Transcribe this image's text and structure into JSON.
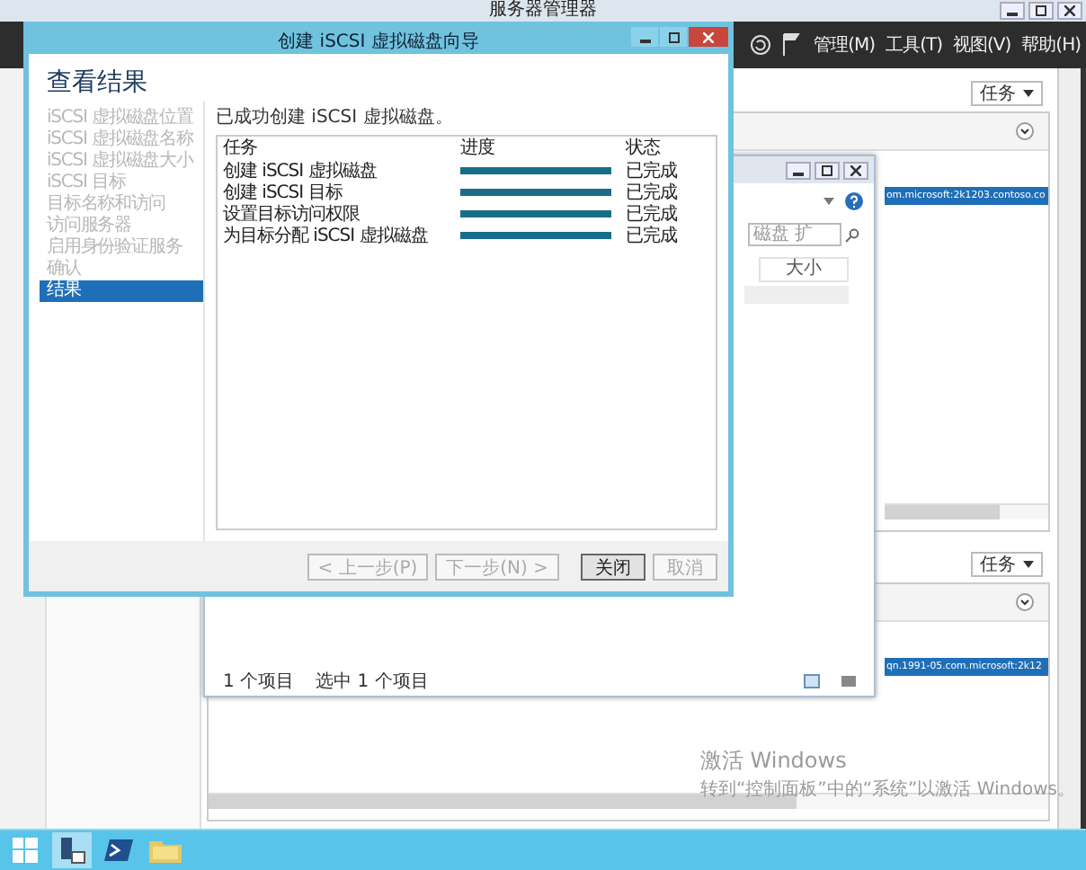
{
  "window": {
    "title": "服务器管理器"
  },
  "header": {
    "menus": [
      "管理(M)",
      "工具(T)",
      "视图(V)",
      "帮助(H)"
    ]
  },
  "panels": [
    {
      "tasks_label": "任务",
      "selected_item": "om.microsoft:2k1203.contoso.co"
    },
    {
      "tasks_label": "任务",
      "selected_item": "qn.1991-05.com.microsoft:2k12"
    }
  ],
  "file_window": {
    "search": {
      "placeholder": "磁盘 扩"
    },
    "column": "大小",
    "status": [
      "1 个项目",
      "选中 1 个项目"
    ]
  },
  "wizard": {
    "title": "创建 iSCSI 虚拟磁盘向导",
    "heading": "查看结果",
    "steps": [
      {
        "label": "iSCSI 虚拟磁盘位置",
        "selected": false
      },
      {
        "label": "iSCSI 虚拟磁盘名称",
        "selected": false
      },
      {
        "label": "iSCSI 虚拟磁盘大小",
        "selected": false
      },
      {
        "label": "iSCSI 目标",
        "selected": false
      },
      {
        "label": "目标名称和访问",
        "selected": false
      },
      {
        "label": "访问服务器",
        "selected": false
      },
      {
        "label": "启用身份验证服务",
        "selected": false
      },
      {
        "label": "确认",
        "selected": false
      },
      {
        "label": "结果",
        "selected": true
      }
    ],
    "message": "已成功创建 iSCSI 虚拟磁盘。",
    "columns": [
      "任务",
      "进度",
      "状态"
    ],
    "rows": [
      {
        "task": "创建 iSCSI 虚拟磁盘",
        "level": 1,
        "status": "已完成"
      },
      {
        "task": "创建 iSCSI 目标",
        "level": 1,
        "status": "已完成"
      },
      {
        "task": "设置目标访问权限",
        "level": 1,
        "status": "已完成"
      },
      {
        "task": "为目标分配 iSCSI 虚拟磁盘",
        "level": 1,
        "status": "已完成"
      }
    ],
    "buttons": [
      {
        "label": "< 上一步(P)",
        "disabled": true,
        "default": false
      },
      {
        "label": "下一步(N) >",
        "disabled": true,
        "default": false
      },
      {
        "label": "关闭",
        "disabled": false,
        "default": true
      },
      {
        "label": "取消",
        "disabled": true,
        "default": false
      }
    ]
  },
  "activation": {
    "title": "激活 Windows",
    "text": "转到“控制面板”中的“系统”以激活 Windows。"
  },
  "taskbar": {
    "items": [
      {
        "kind": "start",
        "selected": false
      },
      {
        "kind": "server",
        "selected": true
      },
      {
        "kind": "powershell",
        "selected": false
      },
      {
        "kind": "folder",
        "selected": false
      }
    ]
  }
}
